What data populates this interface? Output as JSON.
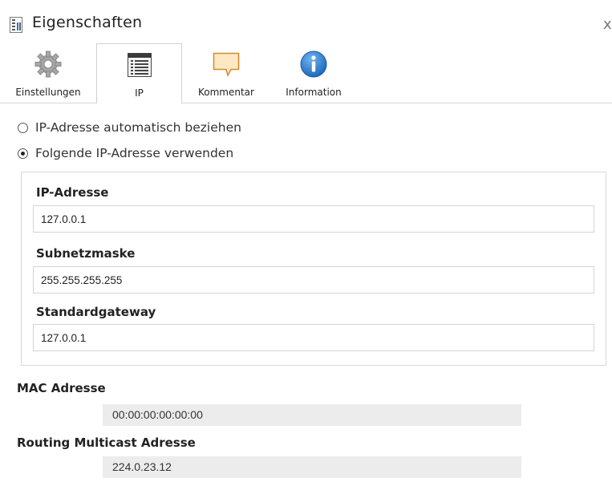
{
  "window": {
    "title": "Eigenschaften",
    "icons": {
      "title": "properties-doc-icon",
      "close": "close-icon"
    },
    "close_glyph": "x"
  },
  "tabs": [
    {
      "label": "Einstellungen",
      "icon": "gear-icon",
      "active": false
    },
    {
      "label": "IP",
      "icon": "network-list-icon",
      "active": true
    },
    {
      "label": "Kommentar",
      "icon": "comment-icon",
      "active": false
    },
    {
      "label": "Information",
      "icon": "info-icon",
      "active": false
    }
  ],
  "ip_mode": {
    "options": [
      {
        "label": "IP-Adresse automatisch beziehen",
        "checked": false
      },
      {
        "label": "Folgende IP-Adresse verwenden",
        "checked": true
      }
    ]
  },
  "fields": {
    "ip_address": {
      "label": "IP-Adresse",
      "value": "127.0.0.1"
    },
    "subnet_mask": {
      "label": "Subnetzmaske",
      "value": "255.255.255.255"
    },
    "default_gateway": {
      "label": "Standardgateway",
      "value": "127.0.0.1"
    }
  },
  "mac": {
    "label": "MAC Adresse",
    "value": "00:00:00:00:00:00"
  },
  "routing_multicast": {
    "label": "Routing Multicast Adresse",
    "value": "224.0.23.12"
  },
  "colors": {
    "gear": "#9a9a9a",
    "comment_fill": "#fce9c4",
    "comment_stroke": "#d8872c",
    "info_blue": "#1e78d2",
    "readonly_bg": "#ececec",
    "border": "#d4d4d4"
  }
}
